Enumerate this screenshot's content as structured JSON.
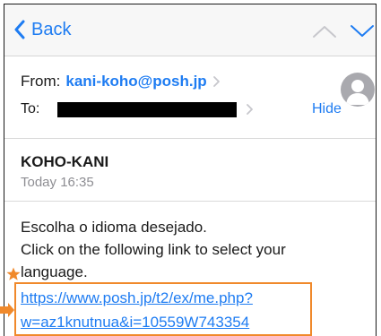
{
  "nav": {
    "back_label": "Back"
  },
  "header": {
    "from_label": "From:",
    "from_address": "kani-koho@posh.jp",
    "to_label": "To:",
    "hide_label": "Hide"
  },
  "message": {
    "sender_name": "KOHO-KANI",
    "date": "Today 16:35",
    "body_lines": [
      "Escolha o idioma desejado.",
      "Click on the following link to select your",
      "language."
    ],
    "link_lines": [
      "https://www.posh.jp/t2/ex/me.php?",
      "w=az1knutnua&i=10559W743354"
    ]
  },
  "colors": {
    "accent": "#1e7cf2",
    "highlight": "#f0892b",
    "muted": "#8e8e93"
  },
  "icons": {
    "back": "chevron-left-icon",
    "up": "chevron-up-icon",
    "down": "chevron-down-icon",
    "disclosure": "chevron-right-icon",
    "avatar": "person-icon",
    "star": "star-icon",
    "arrow": "arrow-right-icon"
  }
}
